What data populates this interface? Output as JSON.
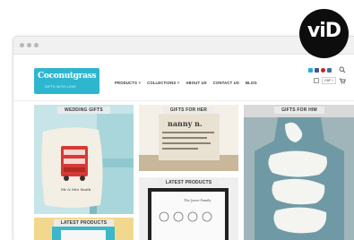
{
  "brand": {
    "logo_text": "Coconutgrass",
    "tagline": "GIFTS WITH LOVE",
    "badge_text": "viD"
  },
  "nav": {
    "items": [
      "PRODUCTS ˅",
      "COLLECTIONS ˅",
      "ABOUT US",
      "CONTACT US",
      "BLOG"
    ]
  },
  "header": {
    "currency": "GBP ˅"
  },
  "tiles": {
    "wedding": "WEDDING GIFTS",
    "her": "GIFTS FOR HER",
    "him": "GIFTS FOR HIM",
    "latest_top": "LATEST PRODUCTS",
    "latest_bottom": "LATEST PRODUCTS"
  },
  "product_text": {
    "cushion_line": "Mr & Mrs Smith",
    "her_name": "nanny n.",
    "print_title": "The Jones Family"
  },
  "colors": {
    "brand_teal": "#2fb6cf",
    "twitter": "#29a9e1",
    "facebook": "#3b5998",
    "pinterest": "#cb2027",
    "instagram": "#3f729b"
  },
  "icons": [
    "twitter-icon",
    "facebook-icon",
    "pinterest-icon",
    "instagram-icon",
    "search-icon",
    "wishlist-icon",
    "cart-icon"
  ]
}
